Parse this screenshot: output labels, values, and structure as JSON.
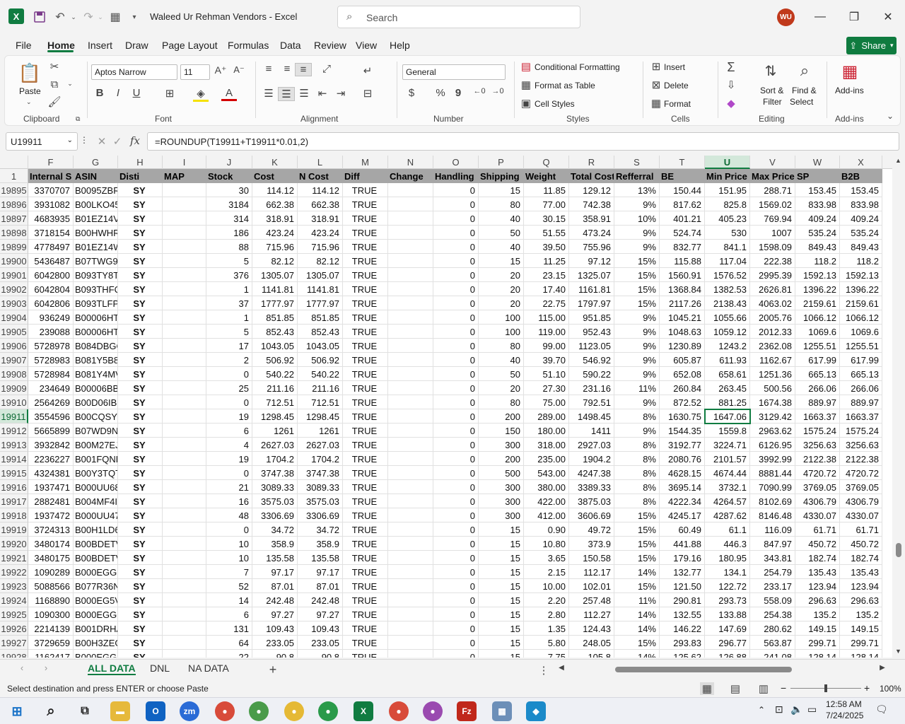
{
  "titlebar": {
    "logo": "X",
    "title": "Waleed Ur Rehman Vendors  -  Excel",
    "search_placeholder": "Search",
    "avatar_initials": "WU"
  },
  "menu": {
    "tabs": [
      "File",
      "Home",
      "Insert",
      "Draw",
      "Page Layout",
      "Formulas",
      "Data",
      "Review",
      "View",
      "Help"
    ],
    "share": "Share"
  },
  "ribbon": {
    "clipboard": {
      "paste": "Paste",
      "group": "Clipboard"
    },
    "font": {
      "name": "Aptos Narrow",
      "size": "11",
      "group": "Font"
    },
    "alignment": {
      "group": "Alignment"
    },
    "number": {
      "format": "General",
      "currency": "$",
      "percent": "%",
      "comma": "9",
      "group": "Number"
    },
    "styles": {
      "conditional": "Conditional Formatting",
      "table": "Format as Table",
      "cell": "Cell Styles",
      "group": "Styles"
    },
    "cells": {
      "insert": "Insert",
      "delete": "Delete",
      "format": "Format",
      "group": "Cells"
    },
    "editing": {
      "sort1": "Sort &",
      "sort2": "Filter",
      "find1": "Find &",
      "find2": "Select",
      "group": "Editing"
    },
    "addins": {
      "label": "Add-ins",
      "group": "Add-ins"
    }
  },
  "formula_bar": {
    "name_box": "U19911",
    "fx": "fx",
    "formula": "=ROUNDUP(T19911+T19911*0.01,2)"
  },
  "columns": [
    "F",
    "G",
    "H",
    "I",
    "J",
    "K",
    "L",
    "M",
    "N",
    "O",
    "P",
    "Q",
    "R",
    "S",
    "T",
    "U",
    "V",
    "W",
    "X"
  ],
  "header_row": {
    "num": "1",
    "cells": [
      "Internal S",
      "ASIN",
      "Disti",
      "MAP",
      "Stock",
      "Cost",
      "N Cost",
      "Diff",
      "Change",
      "Handling",
      "Shipping",
      "Weight",
      "Total Cost",
      "Refferral",
      "BE",
      "Min Price",
      "Max Price",
      "SP",
      "B2B"
    ]
  },
  "rows": [
    [
      "19895",
      "3370707",
      "B0095ZBRI",
      "SY",
      "",
      "30",
      "114.12",
      "114.12",
      "TRUE",
      "",
      "0",
      "15",
      "11.85",
      "129.12",
      "13%",
      "150.44",
      "151.95",
      "288.71",
      "153.45",
      "153.45"
    ],
    [
      "19896",
      "3931082",
      "B00LKO45",
      "SY",
      "",
      "3184",
      "662.38",
      "662.38",
      "TRUE",
      "",
      "0",
      "80",
      "77.00",
      "742.38",
      "9%",
      "817.62",
      "825.8",
      "1569.02",
      "833.98",
      "833.98"
    ],
    [
      "19897",
      "4683935",
      "B01EZ14VI",
      "SY",
      "",
      "314",
      "318.91",
      "318.91",
      "TRUE",
      "",
      "0",
      "40",
      "30.15",
      "358.91",
      "10%",
      "401.21",
      "405.23",
      "769.94",
      "409.24",
      "409.24"
    ],
    [
      "19898",
      "3718154",
      "B00HWHR",
      "SY",
      "",
      "186",
      "423.24",
      "423.24",
      "TRUE",
      "",
      "0",
      "50",
      "51.55",
      "473.24",
      "9%",
      "524.74",
      "530",
      "1007",
      "535.24",
      "535.24"
    ],
    [
      "19899",
      "4778497",
      "B01EZ14W",
      "SY",
      "",
      "88",
      "715.96",
      "715.96",
      "TRUE",
      "",
      "0",
      "40",
      "39.50",
      "755.96",
      "9%",
      "832.77",
      "841.1",
      "1598.09",
      "849.43",
      "849.43"
    ],
    [
      "19900",
      "5436487",
      "B07TWG91",
      "SY",
      "",
      "5",
      "82.12",
      "82.12",
      "TRUE",
      "",
      "0",
      "15",
      "11.25",
      "97.12",
      "15%",
      "115.88",
      "117.04",
      "222.38",
      "118.2",
      "118.2"
    ],
    [
      "19901",
      "6042800",
      "B093TY8TF",
      "SY",
      "",
      "376",
      "1305.07",
      "1305.07",
      "TRUE",
      "",
      "0",
      "20",
      "23.15",
      "1325.07",
      "15%",
      "1560.91",
      "1576.52",
      "2995.39",
      "1592.13",
      "1592.13"
    ],
    [
      "19902",
      "6042804",
      "B093THFQ",
      "SY",
      "",
      "1",
      "1141.81",
      "1141.81",
      "TRUE",
      "",
      "0",
      "20",
      "17.40",
      "1161.81",
      "15%",
      "1368.84",
      "1382.53",
      "2626.81",
      "1396.22",
      "1396.22"
    ],
    [
      "19903",
      "6042806",
      "B093TLFPL",
      "SY",
      "",
      "37",
      "1777.97",
      "1777.97",
      "TRUE",
      "",
      "0",
      "20",
      "22.75",
      "1797.97",
      "15%",
      "2117.26",
      "2138.43",
      "4063.02",
      "2159.61",
      "2159.61"
    ],
    [
      "19904",
      "936249",
      "B00006HT",
      "SY",
      "",
      "1",
      "851.85",
      "851.85",
      "TRUE",
      "",
      "0",
      "100",
      "115.00",
      "951.85",
      "9%",
      "1045.21",
      "1055.66",
      "2005.76",
      "1066.12",
      "1066.12"
    ],
    [
      "19905",
      "239088",
      "B00006HT",
      "SY",
      "",
      "5",
      "852.43",
      "852.43",
      "TRUE",
      "",
      "0",
      "100",
      "119.00",
      "952.43",
      "9%",
      "1048.63",
      "1059.12",
      "2012.33",
      "1069.6",
      "1069.6"
    ],
    [
      "19906",
      "5728978",
      "B084DBGC",
      "SY",
      "",
      "17",
      "1043.05",
      "1043.05",
      "TRUE",
      "",
      "0",
      "80",
      "99.00",
      "1123.05",
      "9%",
      "1230.89",
      "1243.2",
      "2362.08",
      "1255.51",
      "1255.51"
    ],
    [
      "19907",
      "5728983",
      "B081Y5B8",
      "SY",
      "",
      "2",
      "506.92",
      "506.92",
      "TRUE",
      "",
      "0",
      "40",
      "39.70",
      "546.92",
      "9%",
      "605.87",
      "611.93",
      "1162.67",
      "617.99",
      "617.99"
    ],
    [
      "19908",
      "5728984",
      "B081Y4MV",
      "SY",
      "",
      "0",
      "540.22",
      "540.22",
      "TRUE",
      "",
      "0",
      "50",
      "51.10",
      "590.22",
      "9%",
      "652.08",
      "658.61",
      "1251.36",
      "665.13",
      "665.13"
    ],
    [
      "19909",
      "234649",
      "B00006BBI",
      "SY",
      "",
      "25",
      "211.16",
      "211.16",
      "TRUE",
      "",
      "0",
      "20",
      "27.30",
      "231.16",
      "11%",
      "260.84",
      "263.45",
      "500.56",
      "266.06",
      "266.06"
    ],
    [
      "19910",
      "2564269",
      "B00D06IBS",
      "SY",
      "",
      "0",
      "712.51",
      "712.51",
      "TRUE",
      "",
      "0",
      "80",
      "75.00",
      "792.51",
      "9%",
      "872.52",
      "881.25",
      "1674.38",
      "889.97",
      "889.97"
    ],
    [
      "19911",
      "3554596",
      "B00CQSYU",
      "SY",
      "",
      "19",
      "1298.45",
      "1298.45",
      "TRUE",
      "",
      "0",
      "200",
      "289.00",
      "1498.45",
      "8%",
      "1630.75",
      "1647.06",
      "3129.42",
      "1663.37",
      "1663.37"
    ],
    [
      "19912",
      "5665899",
      "B07WD9N",
      "SY",
      "",
      "6",
      "1261",
      "1261",
      "TRUE",
      "",
      "0",
      "150",
      "180.00",
      "1411",
      "9%",
      "1544.35",
      "1559.8",
      "2963.62",
      "1575.24",
      "1575.24"
    ],
    [
      "19913",
      "3932842",
      "B00M27EJ",
      "SY",
      "",
      "4",
      "2627.03",
      "2627.03",
      "TRUE",
      "",
      "0",
      "300",
      "318.00",
      "2927.03",
      "8%",
      "3192.77",
      "3224.71",
      "6126.95",
      "3256.63",
      "3256.63"
    ],
    [
      "19914",
      "2236227",
      "B001FQNF",
      "SY",
      "",
      "19",
      "1704.2",
      "1704.2",
      "TRUE",
      "",
      "0",
      "200",
      "235.00",
      "1904.2",
      "8%",
      "2080.76",
      "2101.57",
      "3992.99",
      "2122.38",
      "2122.38"
    ],
    [
      "19915",
      "4324381",
      "B00Y3TQT",
      "SY",
      "",
      "0",
      "3747.38",
      "3747.38",
      "TRUE",
      "",
      "0",
      "500",
      "543.00",
      "4247.38",
      "8%",
      "4628.15",
      "4674.44",
      "8881.44",
      "4720.72",
      "4720.72"
    ],
    [
      "19916",
      "1937471",
      "B000UU68",
      "SY",
      "",
      "21",
      "3089.33",
      "3089.33",
      "TRUE",
      "",
      "0",
      "300",
      "380.00",
      "3389.33",
      "8%",
      "3695.14",
      "3732.1",
      "7090.99",
      "3769.05",
      "3769.05"
    ],
    [
      "19917",
      "2882481",
      "B004MF4II",
      "SY",
      "",
      "16",
      "3575.03",
      "3575.03",
      "TRUE",
      "",
      "0",
      "300",
      "422.00",
      "3875.03",
      "8%",
      "4222.34",
      "4264.57",
      "8102.69",
      "4306.79",
      "4306.79"
    ],
    [
      "19918",
      "1937472",
      "B000UU47",
      "SY",
      "",
      "48",
      "3306.69",
      "3306.69",
      "TRUE",
      "",
      "0",
      "300",
      "412.00",
      "3606.69",
      "15%",
      "4245.17",
      "4287.62",
      "8146.48",
      "4330.07",
      "4330.07"
    ],
    [
      "19919",
      "3724313",
      "B00H1LD6",
      "SY",
      "",
      "0",
      "34.72",
      "34.72",
      "TRUE",
      "",
      "0",
      "15",
      "0.90",
      "49.72",
      "15%",
      "60.49",
      "61.1",
      "116.09",
      "61.71",
      "61.71"
    ],
    [
      "19920",
      "3480174",
      "B00BDETV",
      "SY",
      "",
      "10",
      "358.9",
      "358.9",
      "TRUE",
      "",
      "0",
      "15",
      "10.80",
      "373.9",
      "15%",
      "441.88",
      "446.3",
      "847.97",
      "450.72",
      "450.72"
    ],
    [
      "19921",
      "3480175",
      "B00BDETV",
      "SY",
      "",
      "10",
      "135.58",
      "135.58",
      "TRUE",
      "",
      "0",
      "15",
      "3.65",
      "150.58",
      "15%",
      "179.16",
      "180.95",
      "343.81",
      "182.74",
      "182.74"
    ],
    [
      "19922",
      "1090289",
      "B000EGGR",
      "SY",
      "",
      "7",
      "97.17",
      "97.17",
      "TRUE",
      "",
      "0",
      "15",
      "2.15",
      "112.17",
      "14%",
      "132.77",
      "134.1",
      "254.79",
      "135.43",
      "135.43"
    ],
    [
      "19923",
      "5088566",
      "B077R36N",
      "SY",
      "",
      "52",
      "87.01",
      "87.01",
      "TRUE",
      "",
      "0",
      "15",
      "10.00",
      "102.01",
      "15%",
      "121.50",
      "122.72",
      "233.17",
      "123.94",
      "123.94"
    ],
    [
      "19924",
      "1168890",
      "B000EG5V",
      "SY",
      "",
      "14",
      "242.48",
      "242.48",
      "TRUE",
      "",
      "0",
      "15",
      "2.20",
      "257.48",
      "11%",
      "290.81",
      "293.73",
      "558.09",
      "296.63",
      "296.63"
    ],
    [
      "19925",
      "1090300",
      "B000EGGR",
      "SY",
      "",
      "6",
      "97.27",
      "97.27",
      "TRUE",
      "",
      "0",
      "15",
      "2.80",
      "112.27",
      "14%",
      "132.55",
      "133.88",
      "254.38",
      "135.2",
      "135.2"
    ],
    [
      "19926",
      "2214139",
      "B001DRHA",
      "SY",
      "",
      "131",
      "109.43",
      "109.43",
      "TRUE",
      "",
      "0",
      "15",
      "1.35",
      "124.43",
      "14%",
      "146.22",
      "147.69",
      "280.62",
      "149.15",
      "149.15"
    ],
    [
      "19927",
      "3729659",
      "B00H3ZEG",
      "SY",
      "",
      "64",
      "233.05",
      "233.05",
      "TRUE",
      "",
      "0",
      "15",
      "5.80",
      "248.05",
      "15%",
      "293.83",
      "296.77",
      "563.87",
      "299.71",
      "299.71"
    ],
    [
      "19928",
      "1162417",
      "B000EGGR",
      "SY",
      "",
      "22",
      "90.8",
      "90.8",
      "TRUE",
      "",
      "0",
      "15",
      "7.75",
      "105.8",
      "14%",
      "125.62",
      "126.88",
      "241.08",
      "128.14",
      "128.14"
    ]
  ],
  "selected_row": "19911",
  "selected_col": "U",
  "sheets": [
    "ALL DATA",
    "DNL",
    "NA DATA"
  ],
  "status": {
    "message": "Select destination and press ENTER or choose Paste",
    "zoom": "100%"
  },
  "taskbar": {
    "time": "12:58 AM",
    "date": "7/24/2025"
  },
  "colors": {
    "excel_green": "#107c41",
    "header_fill": "#a6a6a6"
  }
}
